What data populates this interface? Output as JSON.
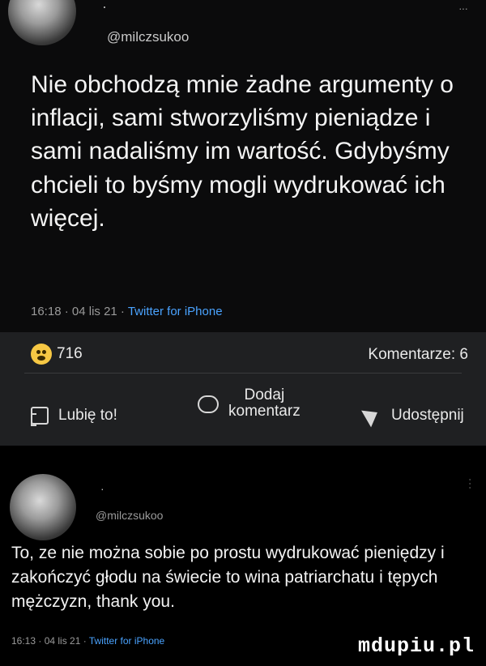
{
  "post1": {
    "handle": "@milczsukoo",
    "dot": "·",
    "more": "···",
    "text": "Nie obchodzą mnie żadne argumenty o inflacji, sami stworzyliśmy pieniądze i sami nadaliśmy im wartość. Gdybyśmy chcieli to byśmy mogli wydrukować ich więcej.",
    "time": "16:18",
    "date": "04 lis 21",
    "source": "Twitter for iPhone",
    "sep": " · "
  },
  "reactions": {
    "count": "716",
    "comments_label": "Komentarze: 6",
    "like_label": "Lubię to!",
    "comment_line1": "Dodaj",
    "comment_line2": "komentarz",
    "share_label": "Udostępnij"
  },
  "post2": {
    "handle": "@milczsukoo",
    "dot": "·",
    "more": "···",
    "text": "To, ze nie można sobie po prostu wydrukować pieniędzy i zakończyć głodu na świecie to wina patriarchatu i tępych mężczyzn, thank you.",
    "time": "16:13",
    "date": "04 lis 21",
    "source": "Twitter for iPhone",
    "sep": " · "
  },
  "watermark": "mdupiu.pl",
  "colors": {
    "link": "#4aa3ff",
    "bar": "#1f2022",
    "emoji": "#f7c844"
  },
  "icons": [
    "laughing-emoji-icon",
    "thumbs-up-icon",
    "comment-icon",
    "share-icon"
  ]
}
